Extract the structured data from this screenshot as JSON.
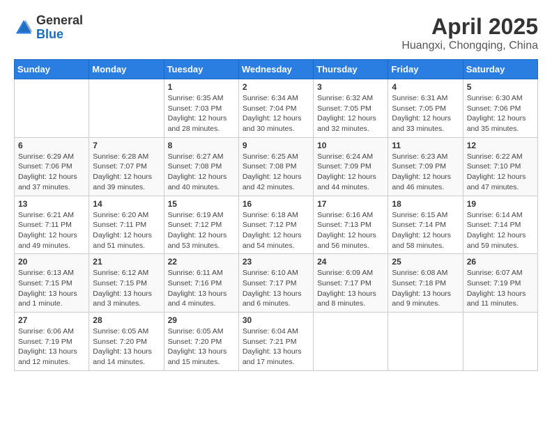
{
  "header": {
    "logo_general": "General",
    "logo_blue": "Blue",
    "month": "April 2025",
    "location": "Huangxi, Chongqing, China"
  },
  "weekdays": [
    "Sunday",
    "Monday",
    "Tuesday",
    "Wednesday",
    "Thursday",
    "Friday",
    "Saturday"
  ],
  "weeks": [
    [
      {
        "day": "",
        "info": ""
      },
      {
        "day": "",
        "info": ""
      },
      {
        "day": "1",
        "info": "Sunrise: 6:35 AM\nSunset: 7:03 PM\nDaylight: 12 hours\nand 28 minutes."
      },
      {
        "day": "2",
        "info": "Sunrise: 6:34 AM\nSunset: 7:04 PM\nDaylight: 12 hours\nand 30 minutes."
      },
      {
        "day": "3",
        "info": "Sunrise: 6:32 AM\nSunset: 7:05 PM\nDaylight: 12 hours\nand 32 minutes."
      },
      {
        "day": "4",
        "info": "Sunrise: 6:31 AM\nSunset: 7:05 PM\nDaylight: 12 hours\nand 33 minutes."
      },
      {
        "day": "5",
        "info": "Sunrise: 6:30 AM\nSunset: 7:06 PM\nDaylight: 12 hours\nand 35 minutes."
      }
    ],
    [
      {
        "day": "6",
        "info": "Sunrise: 6:29 AM\nSunset: 7:06 PM\nDaylight: 12 hours\nand 37 minutes."
      },
      {
        "day": "7",
        "info": "Sunrise: 6:28 AM\nSunset: 7:07 PM\nDaylight: 12 hours\nand 39 minutes."
      },
      {
        "day": "8",
        "info": "Sunrise: 6:27 AM\nSunset: 7:08 PM\nDaylight: 12 hours\nand 40 minutes."
      },
      {
        "day": "9",
        "info": "Sunrise: 6:25 AM\nSunset: 7:08 PM\nDaylight: 12 hours\nand 42 minutes."
      },
      {
        "day": "10",
        "info": "Sunrise: 6:24 AM\nSunset: 7:09 PM\nDaylight: 12 hours\nand 44 minutes."
      },
      {
        "day": "11",
        "info": "Sunrise: 6:23 AM\nSunset: 7:09 PM\nDaylight: 12 hours\nand 46 minutes."
      },
      {
        "day": "12",
        "info": "Sunrise: 6:22 AM\nSunset: 7:10 PM\nDaylight: 12 hours\nand 47 minutes."
      }
    ],
    [
      {
        "day": "13",
        "info": "Sunrise: 6:21 AM\nSunset: 7:11 PM\nDaylight: 12 hours\nand 49 minutes."
      },
      {
        "day": "14",
        "info": "Sunrise: 6:20 AM\nSunset: 7:11 PM\nDaylight: 12 hours\nand 51 minutes."
      },
      {
        "day": "15",
        "info": "Sunrise: 6:19 AM\nSunset: 7:12 PM\nDaylight: 12 hours\nand 53 minutes."
      },
      {
        "day": "16",
        "info": "Sunrise: 6:18 AM\nSunset: 7:12 PM\nDaylight: 12 hours\nand 54 minutes."
      },
      {
        "day": "17",
        "info": "Sunrise: 6:16 AM\nSunset: 7:13 PM\nDaylight: 12 hours\nand 56 minutes."
      },
      {
        "day": "18",
        "info": "Sunrise: 6:15 AM\nSunset: 7:14 PM\nDaylight: 12 hours\nand 58 minutes."
      },
      {
        "day": "19",
        "info": "Sunrise: 6:14 AM\nSunset: 7:14 PM\nDaylight: 12 hours\nand 59 minutes."
      }
    ],
    [
      {
        "day": "20",
        "info": "Sunrise: 6:13 AM\nSunset: 7:15 PM\nDaylight: 13 hours\nand 1 minute."
      },
      {
        "day": "21",
        "info": "Sunrise: 6:12 AM\nSunset: 7:15 PM\nDaylight: 13 hours\nand 3 minutes."
      },
      {
        "day": "22",
        "info": "Sunrise: 6:11 AM\nSunset: 7:16 PM\nDaylight: 13 hours\nand 4 minutes."
      },
      {
        "day": "23",
        "info": "Sunrise: 6:10 AM\nSunset: 7:17 PM\nDaylight: 13 hours\nand 6 minutes."
      },
      {
        "day": "24",
        "info": "Sunrise: 6:09 AM\nSunset: 7:17 PM\nDaylight: 13 hours\nand 8 minutes."
      },
      {
        "day": "25",
        "info": "Sunrise: 6:08 AM\nSunset: 7:18 PM\nDaylight: 13 hours\nand 9 minutes."
      },
      {
        "day": "26",
        "info": "Sunrise: 6:07 AM\nSunset: 7:19 PM\nDaylight: 13 hours\nand 11 minutes."
      }
    ],
    [
      {
        "day": "27",
        "info": "Sunrise: 6:06 AM\nSunset: 7:19 PM\nDaylight: 13 hours\nand 12 minutes."
      },
      {
        "day": "28",
        "info": "Sunrise: 6:05 AM\nSunset: 7:20 PM\nDaylight: 13 hours\nand 14 minutes."
      },
      {
        "day": "29",
        "info": "Sunrise: 6:05 AM\nSunset: 7:20 PM\nDaylight: 13 hours\nand 15 minutes."
      },
      {
        "day": "30",
        "info": "Sunrise: 6:04 AM\nSunset: 7:21 PM\nDaylight: 13 hours\nand 17 minutes."
      },
      {
        "day": "",
        "info": ""
      },
      {
        "day": "",
        "info": ""
      },
      {
        "day": "",
        "info": ""
      }
    ]
  ]
}
